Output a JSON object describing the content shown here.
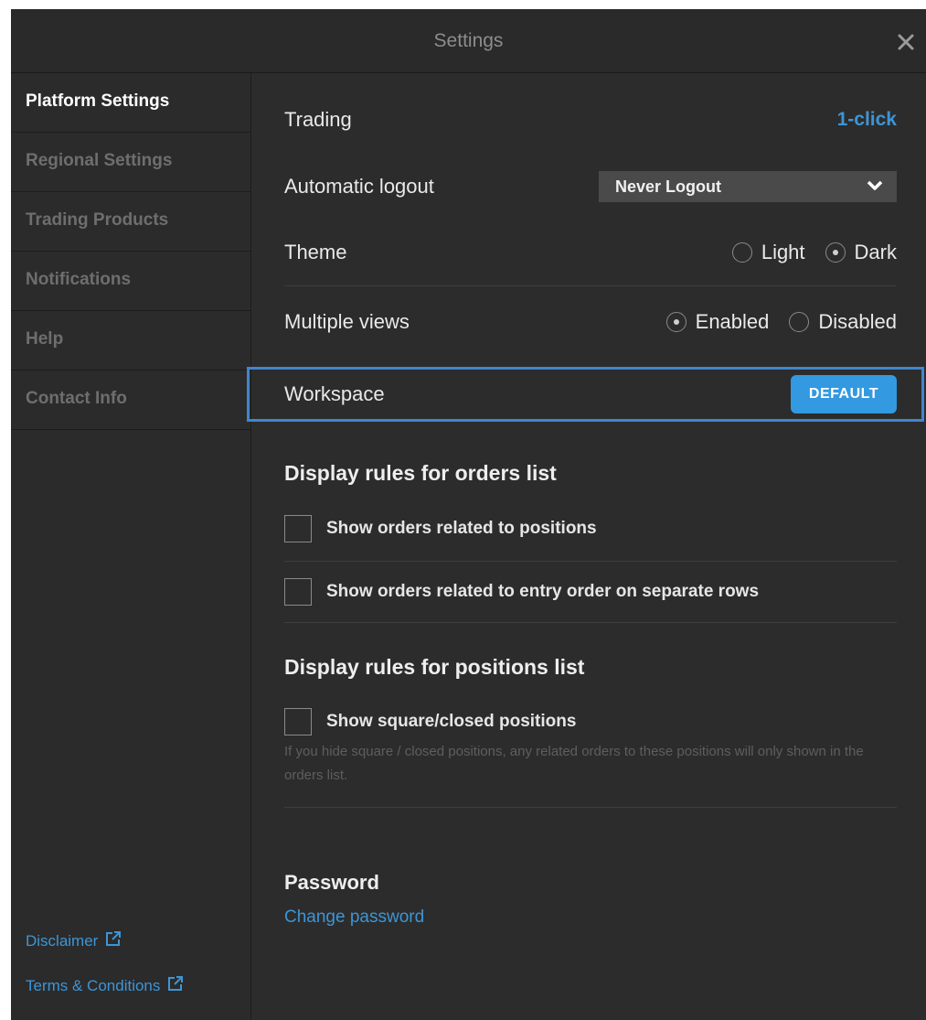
{
  "window": {
    "title": "Settings"
  },
  "sidebar": {
    "items": [
      {
        "label": "Platform Settings",
        "active": true
      },
      {
        "label": "Regional Settings",
        "active": false
      },
      {
        "label": "Trading Products",
        "active": false
      },
      {
        "label": "Notifications",
        "active": false
      },
      {
        "label": "Help",
        "active": false
      },
      {
        "label": "Contact Info",
        "active": false
      }
    ],
    "links": [
      {
        "label": "Disclaimer",
        "icon": "external-link-icon"
      },
      {
        "label": "Terms & Conditions",
        "icon": "external-link-icon"
      }
    ]
  },
  "settings": {
    "trading": {
      "label": "Trading",
      "value": "1-click"
    },
    "logout": {
      "label": "Automatic logout",
      "value": "Never Logout"
    },
    "theme": {
      "label": "Theme",
      "options": [
        "Light",
        "Dark"
      ],
      "selected": "Dark"
    },
    "views": {
      "label": "Multiple views",
      "options": [
        "Enabled",
        "Disabled"
      ],
      "selected": "Enabled"
    },
    "workspace": {
      "label": "Workspace",
      "button": "DEFAULT"
    }
  },
  "orders": {
    "title": "Display rules for orders list",
    "options": [
      {
        "label": "Show orders related to positions",
        "checked": false
      },
      {
        "label": "Show orders related to entry order on separate rows",
        "checked": false
      }
    ]
  },
  "positions": {
    "title": "Display rules for positions list",
    "options": [
      {
        "label": "Show square/closed positions",
        "checked": false
      }
    ],
    "hint": "If you hide square / closed positions, any related orders to these positions will only shown in the orders list."
  },
  "password": {
    "title": "Password",
    "link": "Change password"
  },
  "colors": {
    "background": "#2c2c2c",
    "accent": "#3d95d6",
    "highlight_border": "#3f86cf",
    "button": "#3399e0"
  }
}
